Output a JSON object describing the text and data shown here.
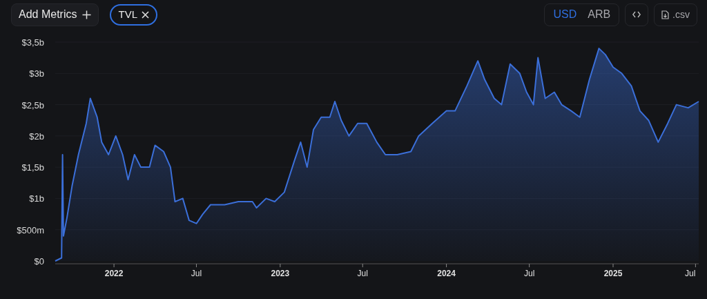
{
  "toolbar": {
    "add_metrics": "Add Metrics",
    "metrics": [
      {
        "label": "TVL"
      }
    ],
    "denominations": [
      {
        "label": "USD",
        "selected": true
      },
      {
        "label": "ARB",
        "selected": false
      }
    ],
    "csv": ".csv"
  },
  "chart": {
    "chart_data": {
      "type": "area",
      "grid": true,
      "x": [
        "2021-08-25",
        "2021-09-08",
        "2021-09-10",
        "2021-09-12",
        "2021-09-20",
        "2021-10-01",
        "2021-10-15",
        "2021-11-01",
        "2021-11-10",
        "2021-11-25",
        "2021-12-05",
        "2021-12-20",
        "2022-01-05",
        "2022-01-20",
        "2022-02-01",
        "2022-02-15",
        "2022-03-01",
        "2022-03-20",
        "2022-04-01",
        "2022-04-20",
        "2022-05-05",
        "2022-05-15",
        "2022-06-01",
        "2022-06-15",
        "2022-07-01",
        "2022-07-15",
        "2022-08-01",
        "2022-09-01",
        "2022-10-01",
        "2022-11-01",
        "2022-11-10",
        "2022-12-01",
        "2022-12-20",
        "2023-01-10",
        "2023-02-01",
        "2023-02-15",
        "2023-03-01",
        "2023-03-15",
        "2023-04-01",
        "2023-04-20",
        "2023-05-01",
        "2023-05-15",
        "2023-06-01",
        "2023-06-20",
        "2023-07-10",
        "2023-08-01",
        "2023-08-20",
        "2023-09-15",
        "2023-10-15",
        "2023-11-01",
        "2023-12-01",
        "2024-01-01",
        "2024-01-20",
        "2024-02-15",
        "2024-03-10",
        "2024-03-25",
        "2024-04-15",
        "2024-05-01",
        "2024-05-20",
        "2024-06-10",
        "2024-06-25",
        "2024-07-10",
        "2024-07-20",
        "2024-08-05",
        "2024-08-25",
        "2024-09-10",
        "2024-10-01",
        "2024-10-20",
        "2024-11-10",
        "2024-12-01",
        "2024-12-15",
        "2025-01-01",
        "2025-01-20",
        "2025-02-10",
        "2025-03-01",
        "2025-03-20",
        "2025-04-10",
        "2025-05-01",
        "2025-05-20",
        "2025-06-15",
        "2025-07-08"
      ],
      "series": [
        {
          "color": "#3b6fd9",
          "values": [
            0,
            50000000,
            1700000000,
            400000000,
            700000000,
            1200000000,
            1700000000,
            2200000000,
            2600000000,
            2300000000,
            1900000000,
            1700000000,
            2000000000,
            1700000000,
            1300000000,
            1700000000,
            1500000000,
            1500000000,
            1850000000,
            1750000000,
            1500000000,
            950000000,
            1000000000,
            650000000,
            600000000,
            750000000,
            900000000,
            900000000,
            950000000,
            950000000,
            850000000,
            1000000000,
            950000000,
            1100000000,
            1600000000,
            1900000000,
            1500000000,
            2100000000,
            2300000000,
            2300000000,
            2550000000,
            2250000000,
            2000000000,
            2200000000,
            2200000000,
            1900000000,
            1700000000,
            1700000000,
            1750000000,
            2000000000,
            2200000000,
            2400000000,
            2400000000,
            2800000000,
            3200000000,
            2900000000,
            2600000000,
            2500000000,
            3150000000,
            3000000000,
            2700000000,
            2500000000,
            3250000000,
            2600000000,
            2700000000,
            2500000000,
            2400000000,
            2300000000,
            2900000000,
            3400000000,
            3300000000,
            3100000000,
            3000000000,
            2800000000,
            2400000000,
            2250000000,
            1900000000,
            2200000000,
            2500000000,
            2450000000,
            2550000000
          ]
        }
      ],
      "xlim": [
        "2021-08-25",
        "2025-07-08"
      ],
      "ylim": [
        0,
        3500000000
      ],
      "xticks": [
        {
          "value": "2022-01-01",
          "label": "2022"
        },
        {
          "value": "2022-07-01",
          "label": "Jul"
        },
        {
          "value": "2023-01-01",
          "label": "2023"
        },
        {
          "value": "2023-07-01",
          "label": "Jul"
        },
        {
          "value": "2024-01-01",
          "label": "2024"
        },
        {
          "value": "2024-07-01",
          "label": "Jul"
        },
        {
          "value": "2025-01-01",
          "label": "2025"
        },
        {
          "value": "2025-07-01",
          "label": "Jul"
        }
      ],
      "yticks": [
        {
          "value": 0,
          "label": "$0"
        },
        {
          "value": 500000000,
          "label": "$500m"
        },
        {
          "value": 1000000000,
          "label": "$1b"
        },
        {
          "value": 1500000000,
          "label": "$1,5b"
        },
        {
          "value": 2000000000,
          "label": "$2b"
        },
        {
          "value": 2500000000,
          "label": "$2,5b"
        },
        {
          "value": 3000000000,
          "label": "$3b"
        },
        {
          "value": 3500000000,
          "label": "$3,5b"
        }
      ]
    }
  }
}
